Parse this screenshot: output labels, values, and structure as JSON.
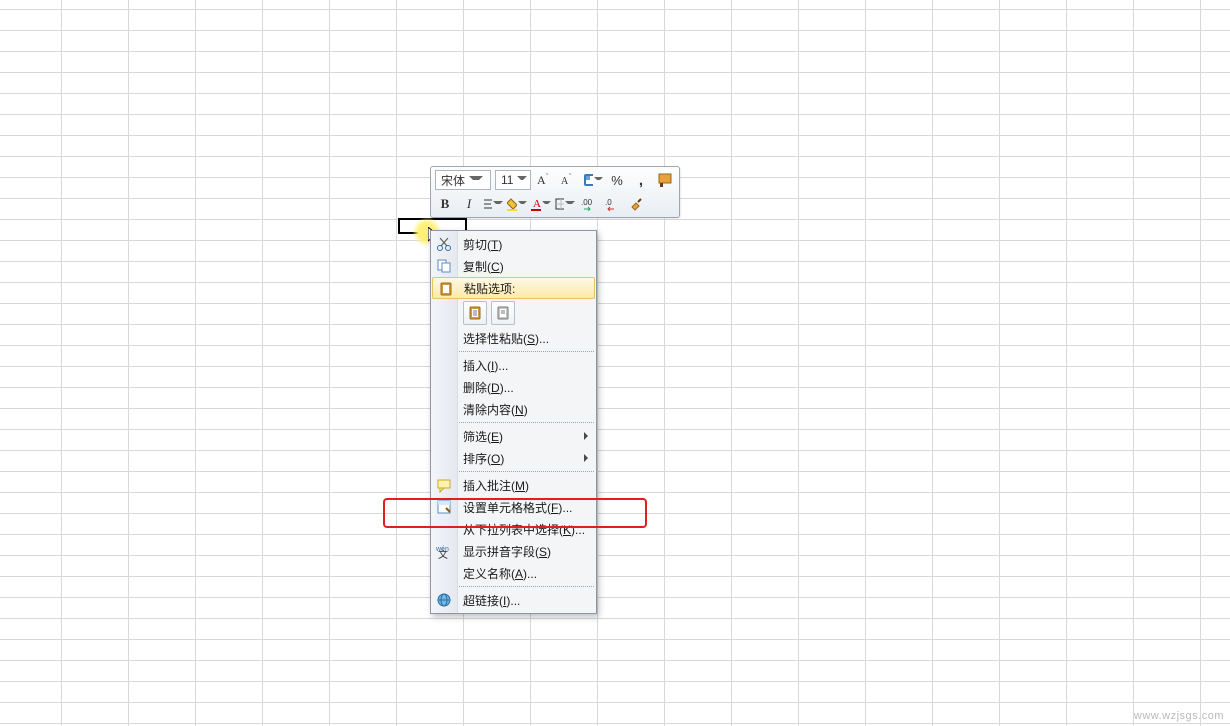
{
  "miniToolbar": {
    "fontName": "宋体",
    "fontSize": "11",
    "currency": "￥",
    "percent": "%",
    "sepComma": ",",
    "bold": "B",
    "italic": "I",
    "letterA": "A"
  },
  "contextMenu": {
    "cut": {
      "label": "剪切",
      "mnemonic": "T"
    },
    "copy": {
      "label": "复制",
      "mnemonic": "C"
    },
    "pasteOptions": {
      "label": "粘贴选项:"
    },
    "pasteSpecial": {
      "label": "选择性粘贴",
      "mnemonic": "S",
      "suffix": "..."
    },
    "insert": {
      "label": "插入",
      "mnemonic": "I",
      "suffix": "..."
    },
    "delete": {
      "label": "删除",
      "mnemonic": "D",
      "suffix": "..."
    },
    "clear": {
      "label": "清除内容",
      "mnemonic": "N"
    },
    "filter": {
      "label": "筛选",
      "mnemonic": "E"
    },
    "sort": {
      "label": "排序",
      "mnemonic": "O"
    },
    "comment": {
      "label": "插入批注",
      "mnemonic": "M"
    },
    "formatCells": {
      "label": "设置单元格格式",
      "mnemonic": "F",
      "suffix": "..."
    },
    "pickList": {
      "label": "从下拉列表中选择",
      "mnemonic": "K",
      "suffix": "..."
    },
    "phonetic": {
      "label": "显示拼音字段",
      "mnemonic": "S"
    },
    "defineName": {
      "label": "定义名称",
      "mnemonic": "A",
      "suffix": "..."
    },
    "hyperlink": {
      "label": "超链接",
      "mnemonic": "I",
      "suffix": "..."
    }
  },
  "watermark": "www.wzjsgs.com"
}
